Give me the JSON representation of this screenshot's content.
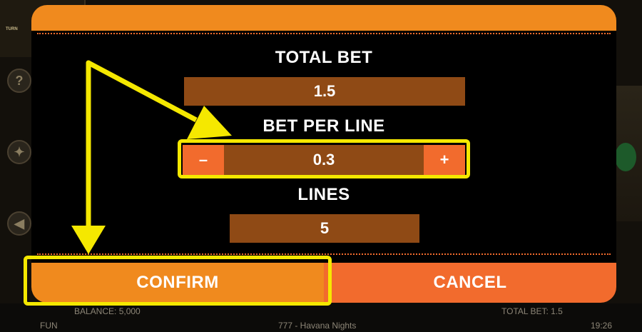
{
  "background": {
    "balance_text": "BALANCE: 5,000",
    "mode_text": "FUN",
    "game_title": "777 - Havana Nights",
    "total_bet_text": "TOTAL BET: 1.5",
    "clock": "19:26",
    "left_panel_text": "TURN",
    "help_icon": "?"
  },
  "dialog": {
    "total_bet_label": "TOTAL BET",
    "total_bet_value": "1.5",
    "bet_per_line_label": "BET PER LINE",
    "bet_per_line_value": "0.3",
    "decrease_label": "–",
    "increase_label": "+",
    "lines_label": "LINES",
    "lines_value": "5",
    "confirm_label": "CONFIRM",
    "cancel_label": "CANCEL"
  },
  "colors": {
    "header_orange": "#f08a1e",
    "button_red_orange": "#f26b2d",
    "value_brown": "#8f4a15",
    "highlight_yellow": "#f5e800"
  },
  "annotations": {
    "icons": [
      "arrow-to-bet-per-line",
      "arrow-to-confirm"
    ]
  }
}
